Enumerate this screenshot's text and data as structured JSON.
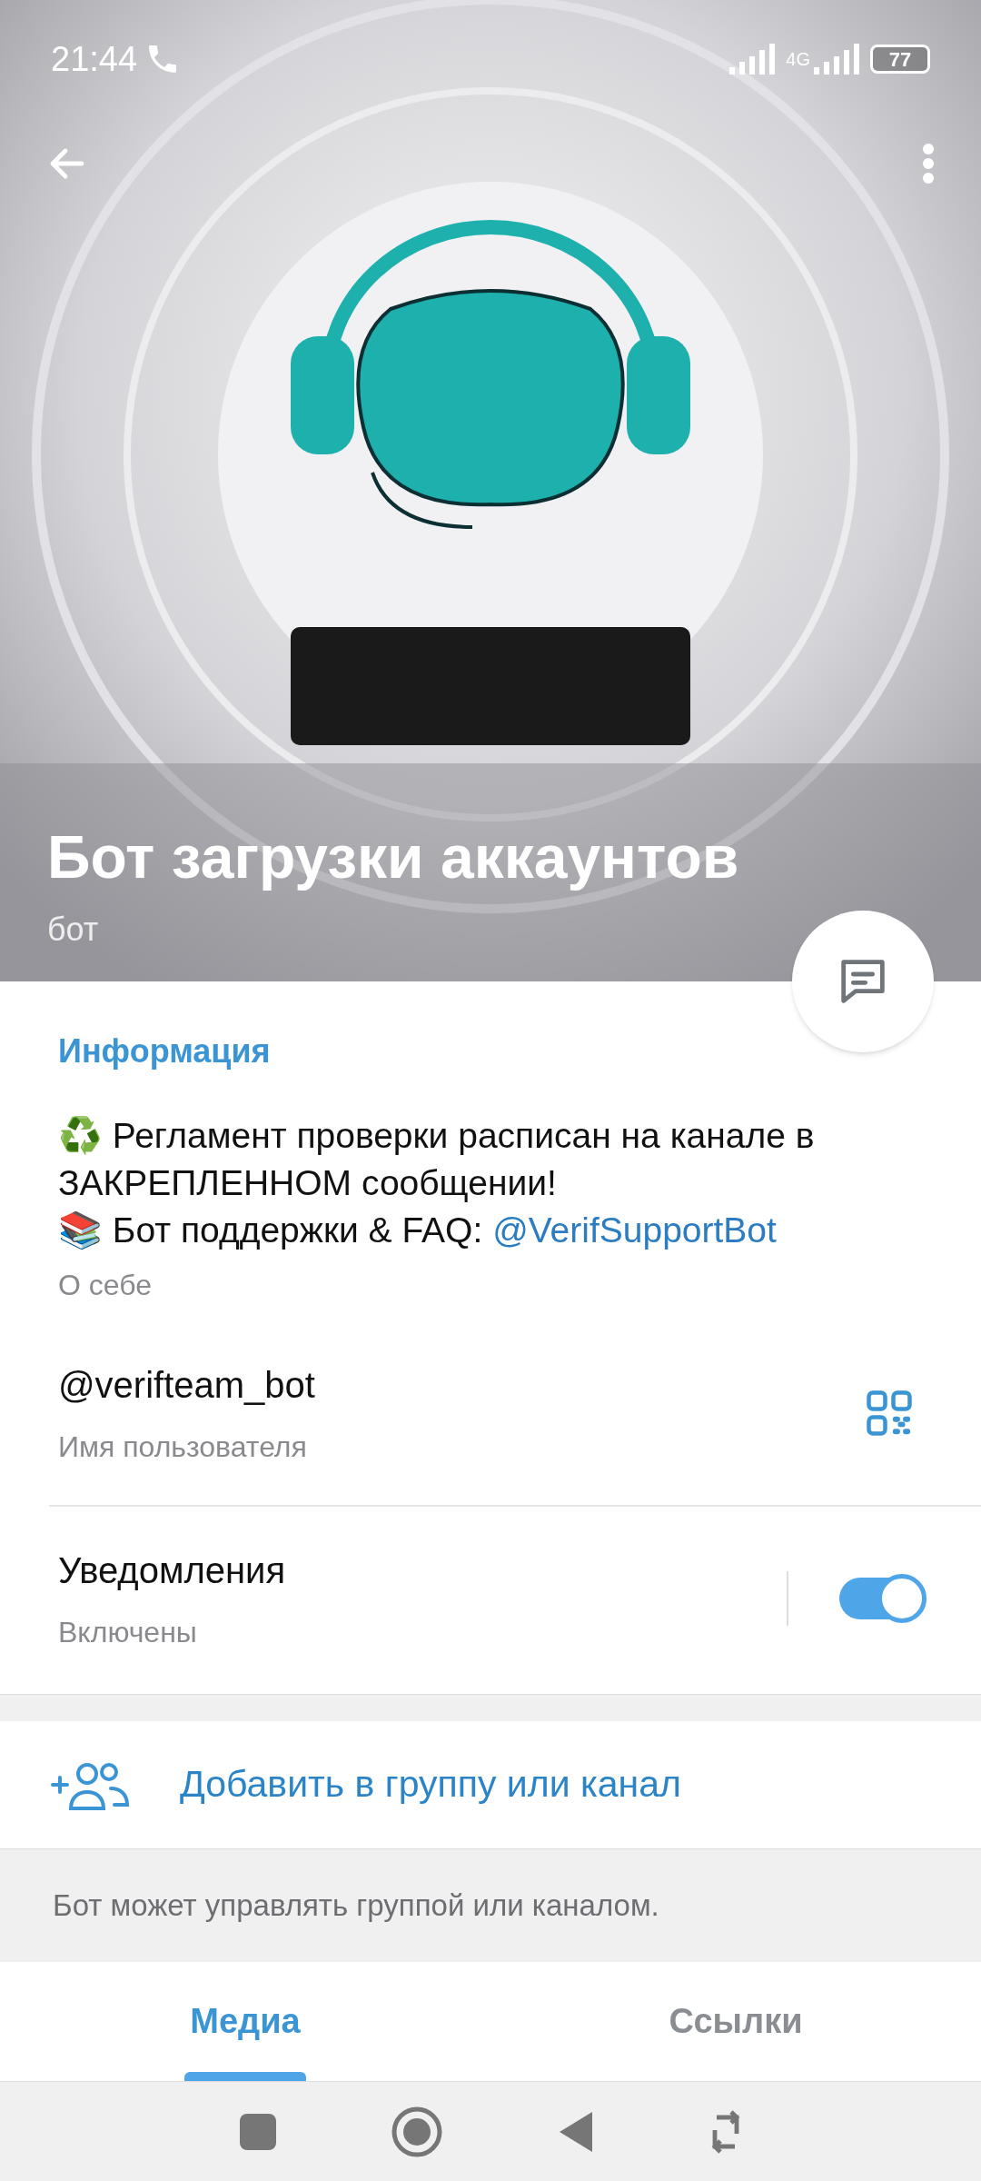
{
  "status_bar": {
    "time": "21:44",
    "network": "4G",
    "battery": "77"
  },
  "header": {
    "title": "Бот загрузки аккаунтов",
    "subtitle": "бот"
  },
  "info": {
    "heading": "Информация",
    "about": {
      "line_1": "♻️ Регламент проверки расписан на канале в ЗАКРЕПЛЕННОМ сообщении!",
      "line_2": "📚 Бот поддержки & FAQ: ",
      "link": "@VerifSupportBot",
      "caption": "О себе"
    },
    "username": {
      "value": "@verifteam_bot",
      "caption": "Имя пользователя"
    },
    "notifications": {
      "title": "Уведомления",
      "caption": "Включены",
      "on": true
    }
  },
  "add_action": {
    "label": "Добавить в группу или канал"
  },
  "hint": "Бот может управлять группой или каналом.",
  "tabs": [
    {
      "label": "Медиа",
      "selected": true
    },
    {
      "label": "Ссылки",
      "selected": false
    }
  ]
}
